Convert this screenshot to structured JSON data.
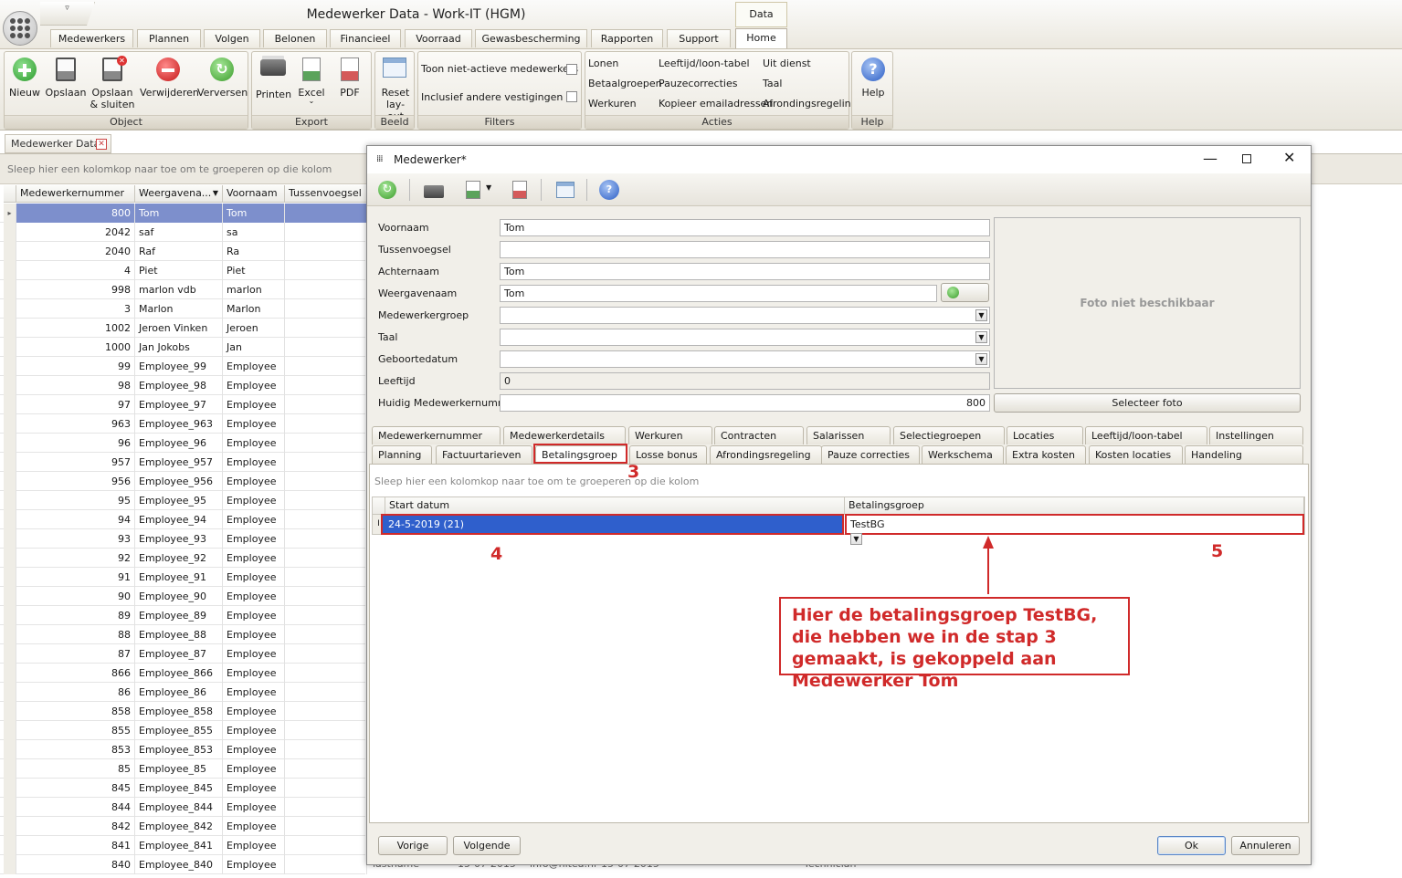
{
  "window": {
    "title": "Medewerker Data - Work-IT (HGM)",
    "context_group": "Data",
    "qat_label": "▿"
  },
  "tabs": [
    "Medewerkers",
    "Plannen",
    "Volgen",
    "Belonen",
    "Financieel",
    "Voorraad",
    "Gewasbescherming",
    "Rapporten",
    "Support",
    "Home"
  ],
  "ribbon": {
    "object": {
      "label": "Object",
      "buttons": [
        "Nieuw",
        "Opslaan",
        "Opslaan & sluiten",
        "Verwijderen",
        "Verversen"
      ]
    },
    "export": {
      "label": "Export",
      "buttons": [
        "Printen",
        "Excel",
        "PDF"
      ]
    },
    "beeld": {
      "label": "Beeld",
      "reset": "Reset lay-out"
    },
    "filters": {
      "label": "Filters",
      "items": [
        "Toon niet-actieve medewerkers",
        "Inclusief andere vestigingen"
      ]
    },
    "acties": {
      "label": "Acties",
      "col1": [
        "Lonen",
        "Betaalgroepen",
        "Werkuren"
      ],
      "col2": [
        "Leeftijd/loon-tabel",
        "Pauzecorrecties",
        "Kopieer emailadressen"
      ],
      "col3": [
        "Uit dienst",
        "Taal",
        "Afrondingsregeling"
      ]
    },
    "help": {
      "label": "Help",
      "button": "Help"
    }
  },
  "doc_tab": "Medewerker Data",
  "group_hint": "Sleep hier een kolomkop naar toe om te groeperen op die kolom",
  "grid": {
    "columns": [
      "Medewerkernummer",
      "Weergavena...",
      "Voornaam",
      "Tussenvoegsel"
    ],
    "rows": [
      [
        "800",
        "Tom",
        "Tom"
      ],
      [
        "2042",
        "saf",
        "sa"
      ],
      [
        "2040",
        "Raf",
        "Ra"
      ],
      [
        "4",
        "Piet",
        "Piet"
      ],
      [
        "998",
        "marlon vdb",
        "marlon"
      ],
      [
        "3",
        "Marlon",
        "Marlon"
      ],
      [
        "1002",
        "Jeroen Vinken",
        "Jeroen"
      ],
      [
        "1000",
        "Jan Jokobs",
        "Jan"
      ],
      [
        "99",
        "Employee_99",
        "Employee"
      ],
      [
        "98",
        "Employee_98",
        "Employee"
      ],
      [
        "97",
        "Employee_97",
        "Employee"
      ],
      [
        "963",
        "Employee_963",
        "Employee"
      ],
      [
        "96",
        "Employee_96",
        "Employee"
      ],
      [
        "957",
        "Employee_957",
        "Employee"
      ],
      [
        "956",
        "Employee_956",
        "Employee"
      ],
      [
        "95",
        "Employee_95",
        "Employee"
      ],
      [
        "94",
        "Employee_94",
        "Employee"
      ],
      [
        "93",
        "Employee_93",
        "Employee"
      ],
      [
        "92",
        "Employee_92",
        "Employee"
      ],
      [
        "91",
        "Employee_91",
        "Employee"
      ],
      [
        "90",
        "Employee_90",
        "Employee"
      ],
      [
        "89",
        "Employee_89",
        "Employee"
      ],
      [
        "88",
        "Employee_88",
        "Employee"
      ],
      [
        "87",
        "Employee_87",
        "Employee"
      ],
      [
        "866",
        "Employee_866",
        "Employee"
      ],
      [
        "86",
        "Employee_86",
        "Employee"
      ],
      [
        "858",
        "Employee_858",
        "Employee"
      ],
      [
        "855",
        "Employee_855",
        "Employee"
      ],
      [
        "853",
        "Employee_853",
        "Employee"
      ],
      [
        "85",
        "Employee_85",
        "Employee"
      ],
      [
        "845",
        "Employee_845",
        "Employee"
      ],
      [
        "844",
        "Employee_844",
        "Employee"
      ],
      [
        "842",
        "Employee_842",
        "Employee"
      ],
      [
        "841",
        "Employee_841",
        "Employee"
      ],
      [
        "840",
        "Employee_840",
        "Employee"
      ]
    ],
    "peek": [
      "lastname",
      "15-07-2015",
      "info@nitea.nl",
      "15-07-2015",
      "Technician"
    ]
  },
  "dialog": {
    "title": "Medewerker*",
    "fields": [
      {
        "label": "Voornaam",
        "value": "Tom"
      },
      {
        "label": "Tussenvoegsel",
        "value": ""
      },
      {
        "label": "Achternaam",
        "value": "Tom"
      },
      {
        "label": "Weergavenaam",
        "value": "Tom"
      },
      {
        "label": "Medewerkergroep",
        "value": ""
      },
      {
        "label": "Taal",
        "value": ""
      },
      {
        "label": "Geboortedatum",
        "value": ""
      },
      {
        "label": "Leeftijd",
        "value": "0"
      },
      {
        "label": "Huidig Medewerkernummer",
        "value": "800"
      }
    ],
    "photo": "Foto niet beschikbaar",
    "select_photo": "Selecteer foto",
    "tabs_row1": [
      "Medewerkernummer",
      "Medewerkerdetails",
      "Werkuren",
      "Contracten",
      "Salarissen",
      "Selectiegroepen",
      "Locaties",
      "Leeftijd/loon-tabel",
      "Instellingen"
    ],
    "tabs_row2": [
      "Planning",
      "Factuurtarieven",
      "Betalingsgroep",
      "Losse bonus",
      "Afrondingsregeling",
      "Pauze correcties",
      "Werkschema",
      "Extra kosten",
      "Kosten locaties",
      "Handeling instellingen"
    ],
    "sub_hint": "Sleep hier een kolomkop naar toe om te groeperen op die kolom",
    "sub_columns": [
      "Start datum",
      "Betalingsgroep"
    ],
    "sub_row": {
      "start": "24-5-2019 (21)",
      "group": "TestBG"
    },
    "buttons": {
      "prev": "Vorige",
      "next": "Volgende",
      "ok": "Ok",
      "cancel": "Annuleren"
    }
  },
  "annotations": {
    "n3": "3",
    "n4": "4",
    "n5": "5",
    "callout": "Hier de betalingsgroep TestBG, die hebben we in de stap 3 gemaakt, is gekoppeld aan Medewerker Tom"
  },
  "colors": {
    "accent_red": "#d02a2a",
    "selection_blue": "#2f5fcc",
    "grid_selection": "#7d8fcc"
  }
}
